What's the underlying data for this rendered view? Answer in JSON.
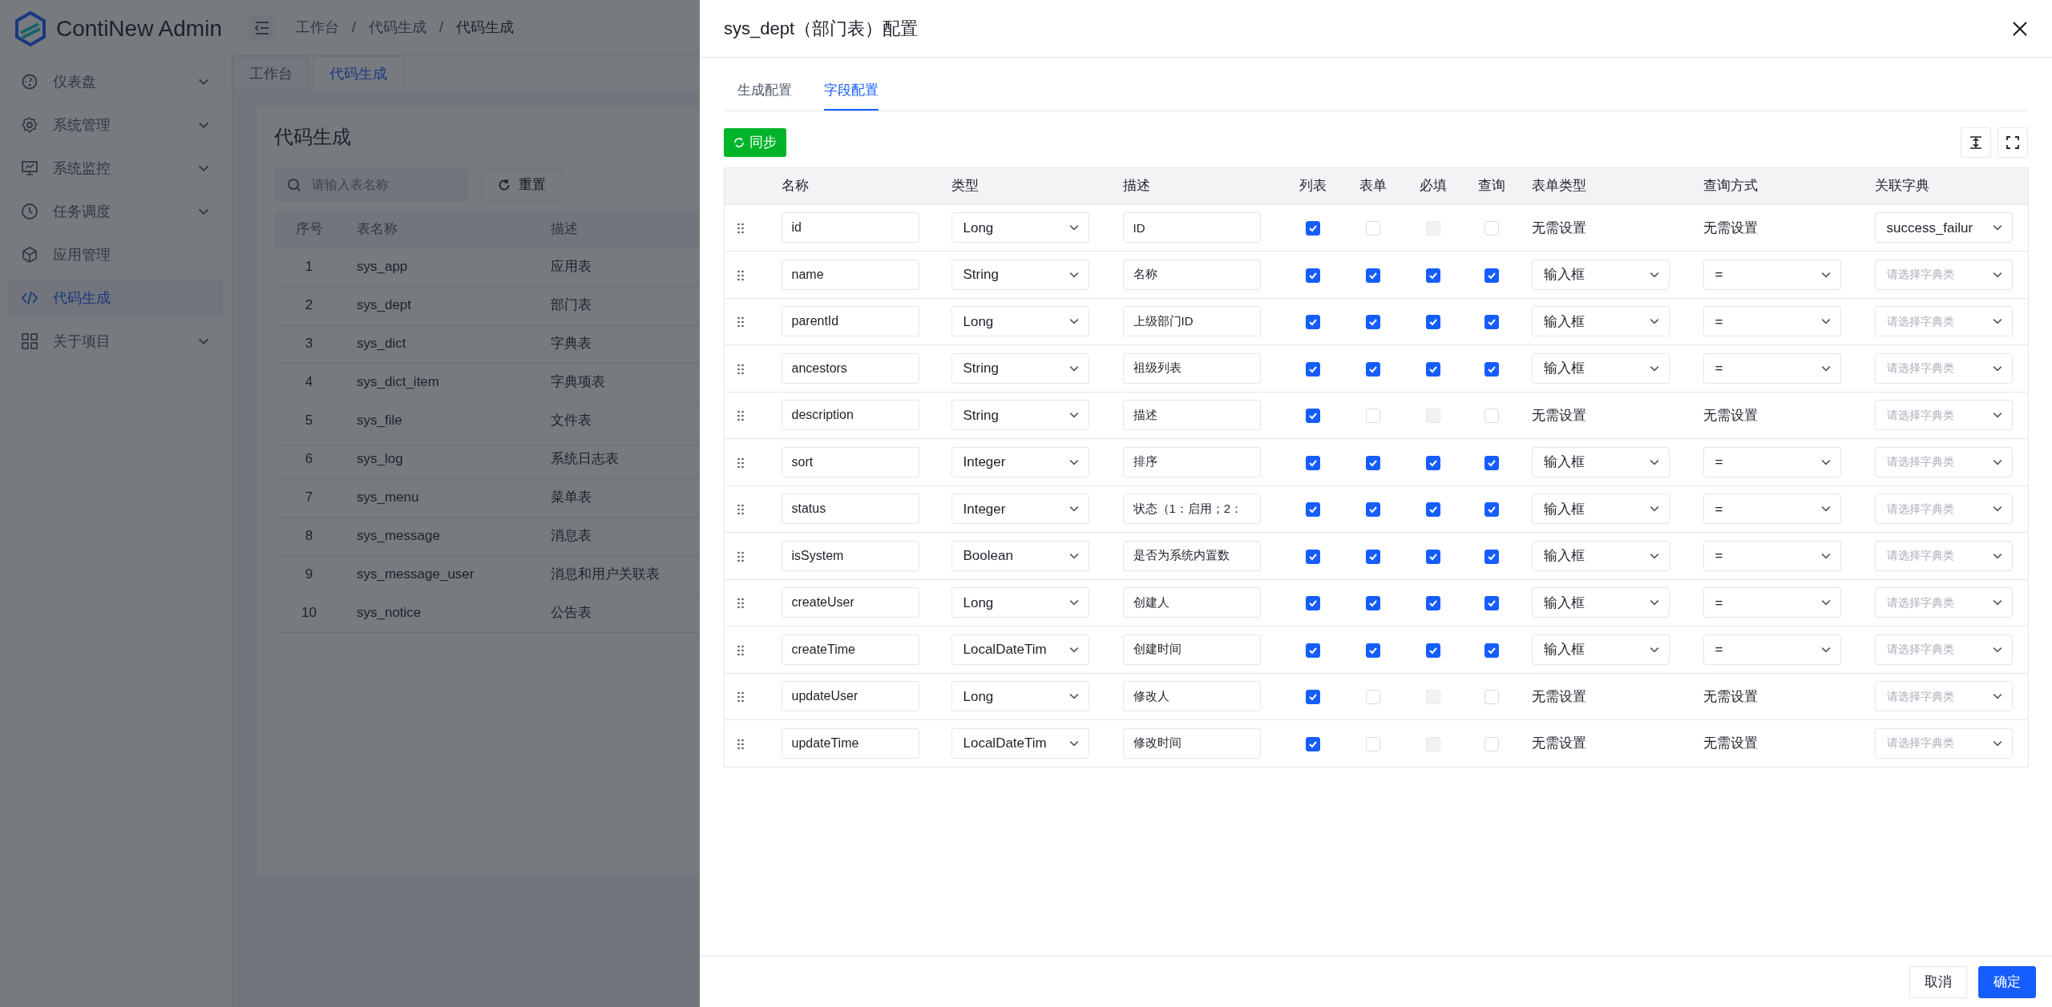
{
  "app": {
    "logo_text": "ContiNew Admin",
    "sidebar": [
      {
        "label": "仪表盘",
        "selected": false,
        "expandable": true
      },
      {
        "label": "系统管理",
        "selected": false,
        "expandable": true
      },
      {
        "label": "系统监控",
        "selected": false,
        "expandable": true
      },
      {
        "label": "任务调度",
        "selected": false,
        "expandable": true
      },
      {
        "label": "应用管理",
        "selected": false,
        "expandable": false
      },
      {
        "label": "代码生成",
        "selected": true,
        "expandable": false
      },
      {
        "label": "关于项目",
        "selected": false,
        "expandable": true
      }
    ],
    "breadcrumb": [
      "工作台",
      "代码生成",
      "代码生成"
    ],
    "breadcrumb_separator": "/",
    "tabs": [
      {
        "label": "工作台",
        "selected": false
      },
      {
        "label": "代码生成",
        "selected": true
      }
    ],
    "page_title": "代码生成",
    "search": {
      "placeholder": "请输入表名称"
    },
    "reset_button": "重置",
    "table": {
      "columns": [
        "序号",
        "表名称",
        "描述"
      ],
      "rows": [
        [
          "1",
          "sys_app",
          "应用表"
        ],
        [
          "2",
          "sys_dept",
          "部门表"
        ],
        [
          "3",
          "sys_dict",
          "字典表"
        ],
        [
          "4",
          "sys_dict_item",
          "字典项表"
        ],
        [
          "5",
          "sys_file",
          "文件表"
        ],
        [
          "6",
          "sys_log",
          "系统日志表"
        ],
        [
          "7",
          "sys_menu",
          "菜单表"
        ],
        [
          "8",
          "sys_message",
          "消息表"
        ],
        [
          "9",
          "sys_message_user",
          "消息和用户关联表"
        ],
        [
          "10",
          "sys_notice",
          "公告表"
        ]
      ]
    }
  },
  "drawer": {
    "title": "sys_dept（部门表）配置",
    "tabs": [
      {
        "label": "生成配置",
        "selected": false
      },
      {
        "label": "字段配置",
        "selected": true
      }
    ],
    "sync_button": "同步",
    "columns": [
      "名称",
      "类型",
      "描述",
      "列表",
      "表单",
      "必填",
      "查询",
      "表单类型",
      "查询方式",
      "关联字典"
    ],
    "rows": [
      {
        "name": "id",
        "type": "Long",
        "description": "ID",
        "list": true,
        "form": false,
        "required": false,
        "required_disabled": true,
        "query": false,
        "form_type": {
          "kind": "text",
          "value": "无需设置"
        },
        "query_mode": {
          "kind": "text",
          "value": "无需设置"
        },
        "dict": {
          "value": "success_failur"
        }
      },
      {
        "name": "name",
        "type": "String",
        "description": "名称",
        "list": true,
        "form": true,
        "required": true,
        "required_disabled": false,
        "query": true,
        "form_type": {
          "kind": "select",
          "value": "输入框"
        },
        "query_mode": {
          "kind": "select",
          "value": "="
        },
        "dict": {
          "placeholder": "请选择字典类"
        }
      },
      {
        "name": "parentId",
        "type": "Long",
        "description": "上级部门ID",
        "list": true,
        "form": true,
        "required": true,
        "required_disabled": false,
        "query": true,
        "form_type": {
          "kind": "select",
          "value": "输入框"
        },
        "query_mode": {
          "kind": "select",
          "value": "="
        },
        "dict": {
          "placeholder": "请选择字典类"
        }
      },
      {
        "name": "ancestors",
        "type": "String",
        "description": "祖级列表",
        "list": true,
        "form": true,
        "required": true,
        "required_disabled": false,
        "query": true,
        "form_type": {
          "kind": "select",
          "value": "输入框"
        },
        "query_mode": {
          "kind": "select",
          "value": "="
        },
        "dict": {
          "placeholder": "请选择字典类"
        }
      },
      {
        "name": "description",
        "type": "String",
        "description": "描述",
        "list": true,
        "form": false,
        "required": false,
        "required_disabled": true,
        "query": false,
        "form_type": {
          "kind": "text",
          "value": "无需设置"
        },
        "query_mode": {
          "kind": "text",
          "value": "无需设置"
        },
        "dict": {
          "placeholder": "请选择字典类"
        }
      },
      {
        "name": "sort",
        "type": "Integer",
        "description": "排序",
        "list": true,
        "form": true,
        "required": true,
        "required_disabled": false,
        "query": true,
        "form_type": {
          "kind": "select",
          "value": "输入框"
        },
        "query_mode": {
          "kind": "select",
          "value": "="
        },
        "dict": {
          "placeholder": "请选择字典类"
        }
      },
      {
        "name": "status",
        "type": "Integer",
        "description": "状态（1：启用；2：",
        "list": true,
        "form": true,
        "required": true,
        "required_disabled": false,
        "query": true,
        "form_type": {
          "kind": "select",
          "value": "输入框"
        },
        "query_mode": {
          "kind": "select",
          "value": "="
        },
        "dict": {
          "placeholder": "请选择字典类"
        }
      },
      {
        "name": "isSystem",
        "type": "Boolean",
        "description": "是否为系统内置数",
        "list": true,
        "form": true,
        "required": true,
        "required_disabled": false,
        "query": true,
        "form_type": {
          "kind": "select",
          "value": "输入框"
        },
        "query_mode": {
          "kind": "select",
          "value": "="
        },
        "dict": {
          "placeholder": "请选择字典类"
        }
      },
      {
        "name": "createUser",
        "type": "Long",
        "description": "创建人",
        "list": true,
        "form": true,
        "required": true,
        "required_disabled": false,
        "query": true,
        "form_type": {
          "kind": "select",
          "value": "输入框"
        },
        "query_mode": {
          "kind": "select",
          "value": "="
        },
        "dict": {
          "placeholder": "请选择字典类"
        }
      },
      {
        "name": "createTime",
        "type": "LocalDateTim",
        "description": "创建时间",
        "list": true,
        "form": true,
        "required": true,
        "required_disabled": false,
        "query": true,
        "form_type": {
          "kind": "select",
          "value": "输入框"
        },
        "query_mode": {
          "kind": "select",
          "value": "="
        },
        "dict": {
          "placeholder": "请选择字典类"
        }
      },
      {
        "name": "updateUser",
        "type": "Long",
        "description": "修改人",
        "list": true,
        "form": false,
        "required": false,
        "required_disabled": true,
        "query": false,
        "form_type": {
          "kind": "text",
          "value": "无需设置"
        },
        "query_mode": {
          "kind": "text",
          "value": "无需设置"
        },
        "dict": {
          "placeholder": "请选择字典类"
        }
      },
      {
        "name": "updateTime",
        "type": "LocalDateTim",
        "description": "修改时间",
        "list": true,
        "form": false,
        "required": false,
        "required_disabled": true,
        "query": false,
        "form_type": {
          "kind": "text",
          "value": "无需设置"
        },
        "query_mode": {
          "kind": "text",
          "value": "无需设置"
        },
        "dict": {
          "placeholder": "请选择字典类"
        }
      }
    ],
    "footer_buttons": [
      {
        "label": "取消",
        "kind": "default"
      },
      {
        "label": "确定",
        "kind": "primary"
      }
    ]
  }
}
